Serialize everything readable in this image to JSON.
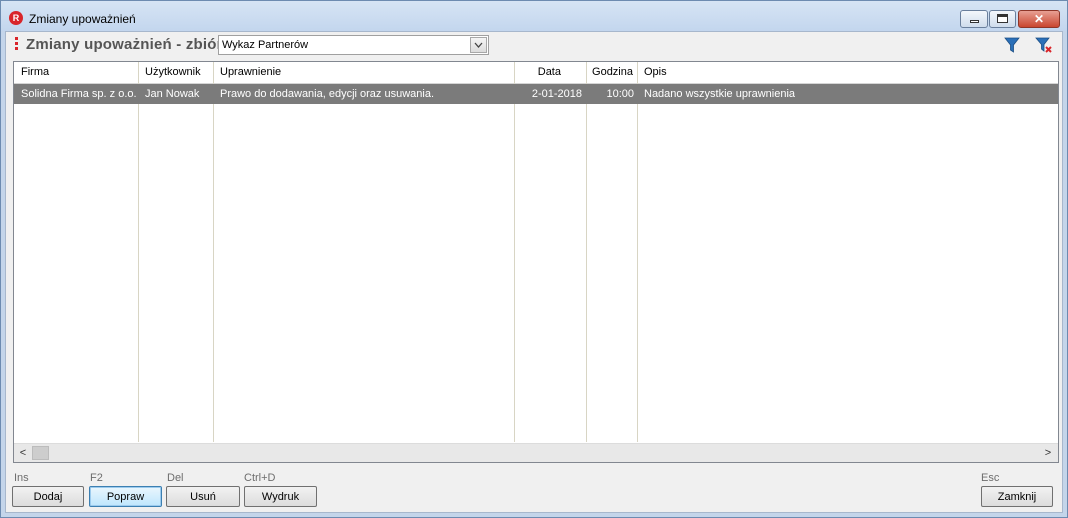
{
  "window": {
    "title": "Zmiany upoważnień",
    "app_icon_letter": "R",
    "close_glyph": "✕"
  },
  "header": {
    "heading": "Zmiany upoważnień - zbiór",
    "combo_value": "Wykaz Partnerów"
  },
  "grid": {
    "columns": [
      "Firma",
      "Użytkownik",
      "Uprawnienie",
      "Data",
      "Godzina",
      "Opis"
    ],
    "rows": [
      {
        "firma": "Solidna Firma sp. z o.o.",
        "uzytkownik": "Jan Nowak",
        "uprawnienie": "Prawo do dodawania, edycji oraz usuwania.",
        "data": "2-01-2018",
        "godzina": "10:00",
        "opis": "Nadano wszystkie uprawnienia"
      }
    ],
    "scroll_left": "<",
    "scroll_right": ">"
  },
  "footer": {
    "buttons": [
      {
        "shortcut": "Ins",
        "label": "Dodaj"
      },
      {
        "shortcut": "F2",
        "label": "Popraw"
      },
      {
        "shortcut": "Del",
        "label": "Usuń"
      },
      {
        "shortcut": "Ctrl+D",
        "label": "Wydruk"
      },
      {
        "shortcut": "Esc",
        "label": "Zamknij"
      }
    ]
  },
  "colors": {
    "selected_row": "#7b7b7b",
    "brand_red": "#d9252a",
    "filter_blue": "#2a6fb8"
  },
  "icons": [
    "app-logo-icon",
    "filter-icon",
    "clear-filter-icon",
    "chevron-down-icon",
    "minimize-icon",
    "maximize-icon",
    "close-icon"
  ]
}
